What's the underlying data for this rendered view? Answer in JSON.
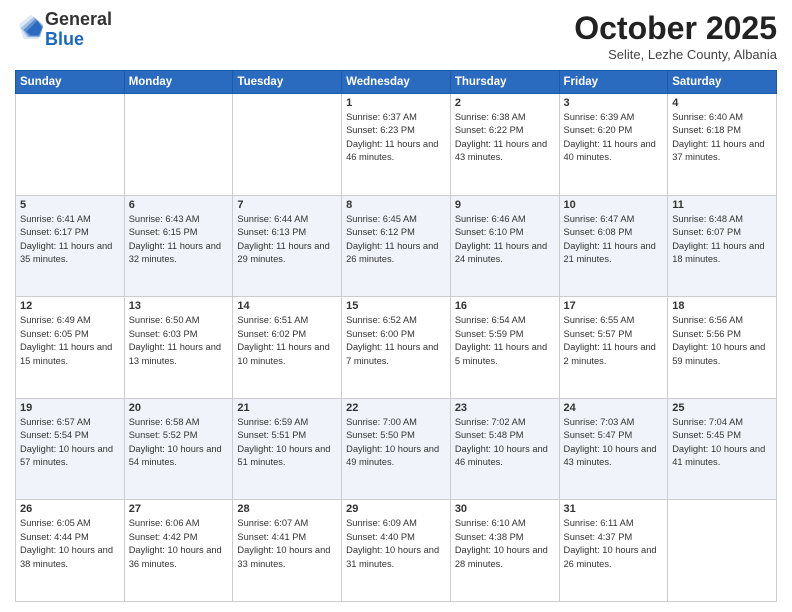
{
  "header": {
    "logo_general": "General",
    "logo_blue": "Blue",
    "month_title": "October 2025",
    "location": "Selite, Lezhe County, Albania"
  },
  "days_of_week": [
    "Sunday",
    "Monday",
    "Tuesday",
    "Wednesday",
    "Thursday",
    "Friday",
    "Saturday"
  ],
  "weeks": [
    {
      "row_alt": false,
      "days": [
        {
          "num": "",
          "sunrise": "",
          "sunset": "",
          "daylight": ""
        },
        {
          "num": "",
          "sunrise": "",
          "sunset": "",
          "daylight": ""
        },
        {
          "num": "",
          "sunrise": "",
          "sunset": "",
          "daylight": ""
        },
        {
          "num": "1",
          "sunrise": "Sunrise: 6:37 AM",
          "sunset": "Sunset: 6:23 PM",
          "daylight": "Daylight: 11 hours and 46 minutes."
        },
        {
          "num": "2",
          "sunrise": "Sunrise: 6:38 AM",
          "sunset": "Sunset: 6:22 PM",
          "daylight": "Daylight: 11 hours and 43 minutes."
        },
        {
          "num": "3",
          "sunrise": "Sunrise: 6:39 AM",
          "sunset": "Sunset: 6:20 PM",
          "daylight": "Daylight: 11 hours and 40 minutes."
        },
        {
          "num": "4",
          "sunrise": "Sunrise: 6:40 AM",
          "sunset": "Sunset: 6:18 PM",
          "daylight": "Daylight: 11 hours and 37 minutes."
        }
      ]
    },
    {
      "row_alt": true,
      "days": [
        {
          "num": "5",
          "sunrise": "Sunrise: 6:41 AM",
          "sunset": "Sunset: 6:17 PM",
          "daylight": "Daylight: 11 hours and 35 minutes."
        },
        {
          "num": "6",
          "sunrise": "Sunrise: 6:43 AM",
          "sunset": "Sunset: 6:15 PM",
          "daylight": "Daylight: 11 hours and 32 minutes."
        },
        {
          "num": "7",
          "sunrise": "Sunrise: 6:44 AM",
          "sunset": "Sunset: 6:13 PM",
          "daylight": "Daylight: 11 hours and 29 minutes."
        },
        {
          "num": "8",
          "sunrise": "Sunrise: 6:45 AM",
          "sunset": "Sunset: 6:12 PM",
          "daylight": "Daylight: 11 hours and 26 minutes."
        },
        {
          "num": "9",
          "sunrise": "Sunrise: 6:46 AM",
          "sunset": "Sunset: 6:10 PM",
          "daylight": "Daylight: 11 hours and 24 minutes."
        },
        {
          "num": "10",
          "sunrise": "Sunrise: 6:47 AM",
          "sunset": "Sunset: 6:08 PM",
          "daylight": "Daylight: 11 hours and 21 minutes."
        },
        {
          "num": "11",
          "sunrise": "Sunrise: 6:48 AM",
          "sunset": "Sunset: 6:07 PM",
          "daylight": "Daylight: 11 hours and 18 minutes."
        }
      ]
    },
    {
      "row_alt": false,
      "days": [
        {
          "num": "12",
          "sunrise": "Sunrise: 6:49 AM",
          "sunset": "Sunset: 6:05 PM",
          "daylight": "Daylight: 11 hours and 15 minutes."
        },
        {
          "num": "13",
          "sunrise": "Sunrise: 6:50 AM",
          "sunset": "Sunset: 6:03 PM",
          "daylight": "Daylight: 11 hours and 13 minutes."
        },
        {
          "num": "14",
          "sunrise": "Sunrise: 6:51 AM",
          "sunset": "Sunset: 6:02 PM",
          "daylight": "Daylight: 11 hours and 10 minutes."
        },
        {
          "num": "15",
          "sunrise": "Sunrise: 6:52 AM",
          "sunset": "Sunset: 6:00 PM",
          "daylight": "Daylight: 11 hours and 7 minutes."
        },
        {
          "num": "16",
          "sunrise": "Sunrise: 6:54 AM",
          "sunset": "Sunset: 5:59 PM",
          "daylight": "Daylight: 11 hours and 5 minutes."
        },
        {
          "num": "17",
          "sunrise": "Sunrise: 6:55 AM",
          "sunset": "Sunset: 5:57 PM",
          "daylight": "Daylight: 11 hours and 2 minutes."
        },
        {
          "num": "18",
          "sunrise": "Sunrise: 6:56 AM",
          "sunset": "Sunset: 5:56 PM",
          "daylight": "Daylight: 10 hours and 59 minutes."
        }
      ]
    },
    {
      "row_alt": true,
      "days": [
        {
          "num": "19",
          "sunrise": "Sunrise: 6:57 AM",
          "sunset": "Sunset: 5:54 PM",
          "daylight": "Daylight: 10 hours and 57 minutes."
        },
        {
          "num": "20",
          "sunrise": "Sunrise: 6:58 AM",
          "sunset": "Sunset: 5:52 PM",
          "daylight": "Daylight: 10 hours and 54 minutes."
        },
        {
          "num": "21",
          "sunrise": "Sunrise: 6:59 AM",
          "sunset": "Sunset: 5:51 PM",
          "daylight": "Daylight: 10 hours and 51 minutes."
        },
        {
          "num": "22",
          "sunrise": "Sunrise: 7:00 AM",
          "sunset": "Sunset: 5:50 PM",
          "daylight": "Daylight: 10 hours and 49 minutes."
        },
        {
          "num": "23",
          "sunrise": "Sunrise: 7:02 AM",
          "sunset": "Sunset: 5:48 PM",
          "daylight": "Daylight: 10 hours and 46 minutes."
        },
        {
          "num": "24",
          "sunrise": "Sunrise: 7:03 AM",
          "sunset": "Sunset: 5:47 PM",
          "daylight": "Daylight: 10 hours and 43 minutes."
        },
        {
          "num": "25",
          "sunrise": "Sunrise: 7:04 AM",
          "sunset": "Sunset: 5:45 PM",
          "daylight": "Daylight: 10 hours and 41 minutes."
        }
      ]
    },
    {
      "row_alt": false,
      "days": [
        {
          "num": "26",
          "sunrise": "Sunrise: 6:05 AM",
          "sunset": "Sunset: 4:44 PM",
          "daylight": "Daylight: 10 hours and 38 minutes."
        },
        {
          "num": "27",
          "sunrise": "Sunrise: 6:06 AM",
          "sunset": "Sunset: 4:42 PM",
          "daylight": "Daylight: 10 hours and 36 minutes."
        },
        {
          "num": "28",
          "sunrise": "Sunrise: 6:07 AM",
          "sunset": "Sunset: 4:41 PM",
          "daylight": "Daylight: 10 hours and 33 minutes."
        },
        {
          "num": "29",
          "sunrise": "Sunrise: 6:09 AM",
          "sunset": "Sunset: 4:40 PM",
          "daylight": "Daylight: 10 hours and 31 minutes."
        },
        {
          "num": "30",
          "sunrise": "Sunrise: 6:10 AM",
          "sunset": "Sunset: 4:38 PM",
          "daylight": "Daylight: 10 hours and 28 minutes."
        },
        {
          "num": "31",
          "sunrise": "Sunrise: 6:11 AM",
          "sunset": "Sunset: 4:37 PM",
          "daylight": "Daylight: 10 hours and 26 minutes."
        },
        {
          "num": "",
          "sunrise": "",
          "sunset": "",
          "daylight": ""
        }
      ]
    }
  ]
}
